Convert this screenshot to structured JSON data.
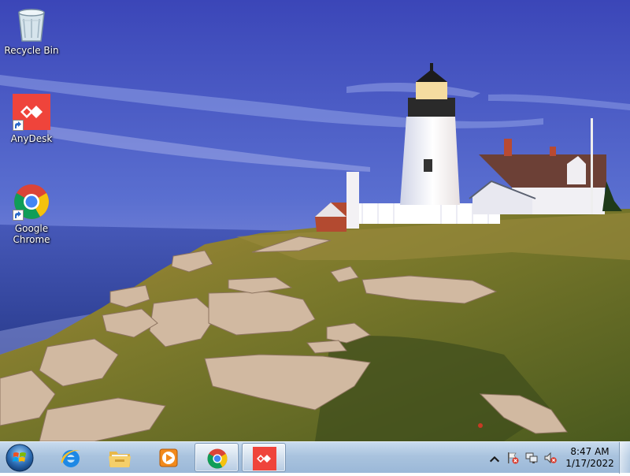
{
  "desktop": {
    "icons": [
      {
        "label": "Recycle Bin",
        "icon": "recycle-bin-icon"
      },
      {
        "label": "AnyDesk",
        "icon": "anydesk-icon"
      },
      {
        "label": "Google\nChrome",
        "icon": "chrome-icon"
      }
    ]
  },
  "taskbar": {
    "start": "start-orb-icon",
    "pinned": [
      {
        "name": "Internet Explorer",
        "icon": "internet-explorer-icon"
      },
      {
        "name": "File Explorer",
        "icon": "folder-icon"
      },
      {
        "name": "Windows Media Player",
        "icon": "media-player-icon"
      },
      {
        "name": "Google Chrome",
        "icon": "chrome-icon",
        "active": true
      },
      {
        "name": "AnyDesk",
        "icon": "anydesk-icon",
        "active": true
      }
    ],
    "tray": {
      "icons": [
        "show-hidden-icons-chevron",
        "action-center-flag-icon",
        "network-icon",
        "volume-muted-icon"
      ],
      "time": "8:47 AM",
      "date": "1/17/2022"
    }
  },
  "colors": {
    "anydesk_red": "#ef443b",
    "taskbar": "#a9c3de"
  }
}
